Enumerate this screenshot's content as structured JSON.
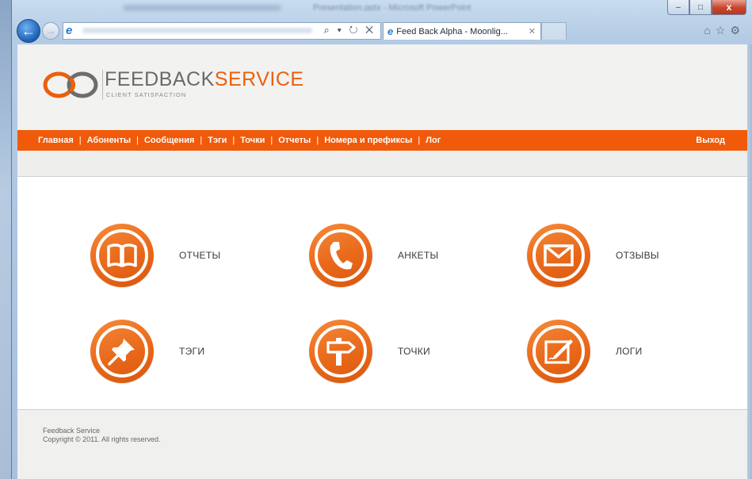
{
  "browser": {
    "window_title": "Presentation.pptx - Microsoft PowerPoint",
    "tab_title": "Feed Back Alpha - Moonlig...",
    "address_tools": "⌕ ▾ ↻ ✕",
    "window_buttons": {
      "minimize": "–",
      "maximize": "□",
      "close": "x"
    },
    "right_icons": [
      "home-icon",
      "star-icon",
      "gear-icon"
    ]
  },
  "logo": {
    "text_a": "FEEDBACK",
    "text_b": "SERVICE",
    "tagline": "CLIENT SATISFACTION"
  },
  "menu": {
    "items": [
      "Главная",
      "Абоненты",
      "Сообщения",
      "Тэги",
      "Точки",
      "Отчеты",
      "Номера и префиксы",
      "Лог"
    ],
    "logout": "Выход"
  },
  "tiles": [
    {
      "label": "ОТЧЕТЫ",
      "icon": "book-icon"
    },
    {
      "label": "АНКЕТЫ",
      "icon": "phone-icon"
    },
    {
      "label": "ОТЗЫВЫ",
      "icon": "envelope-icon"
    },
    {
      "label": "ТЭГИ",
      "icon": "pushpin-icon"
    },
    {
      "label": "ТОЧКИ",
      "icon": "signpost-icon"
    },
    {
      "label": "ЛОГИ",
      "icon": "edit-icon"
    }
  ],
  "footer": {
    "line1": "Feedback Service",
    "line2": "Copyright © 2011. All rights reserved."
  },
  "colors": {
    "accent": "#f05a0a",
    "background": "#f2f2f1"
  }
}
